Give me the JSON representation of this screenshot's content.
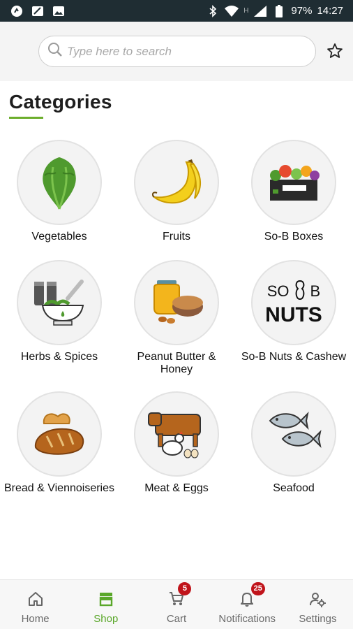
{
  "status_bar": {
    "battery": "97%",
    "time": "14:27",
    "network_label": "H"
  },
  "search": {
    "placeholder": "Type here to search"
  },
  "categories_title": "Categories",
  "categories": [
    {
      "label": "Vegetables"
    },
    {
      "label": "Fruits"
    },
    {
      "label": "So-B Boxes"
    },
    {
      "label": "Herbs & Spices"
    },
    {
      "label": "Peanut Butter & Honey"
    },
    {
      "label": "So-B Nuts & Cashew"
    },
    {
      "label": "Bread & Viennoiseries"
    },
    {
      "label": "Meat & Eggs"
    },
    {
      "label": "Seafood"
    }
  ],
  "nuts_logo": {
    "line1a": "SO",
    "line1b": "B",
    "line2": "NUTS"
  },
  "bottom_nav": [
    {
      "label": "Home",
      "icon": "home-icon"
    },
    {
      "label": "Shop",
      "icon": "shop-icon",
      "active": true
    },
    {
      "label": "Cart",
      "icon": "cart-icon",
      "badge": "5"
    },
    {
      "label": "Notifications",
      "icon": "bell-icon",
      "badge": "25"
    },
    {
      "label": "Settings",
      "icon": "settings-icon"
    }
  ],
  "colors": {
    "accent": "#6cae2c",
    "active_nav": "#5aa72a",
    "badge": "#c0141b",
    "status_bar": "#1f2d33"
  }
}
